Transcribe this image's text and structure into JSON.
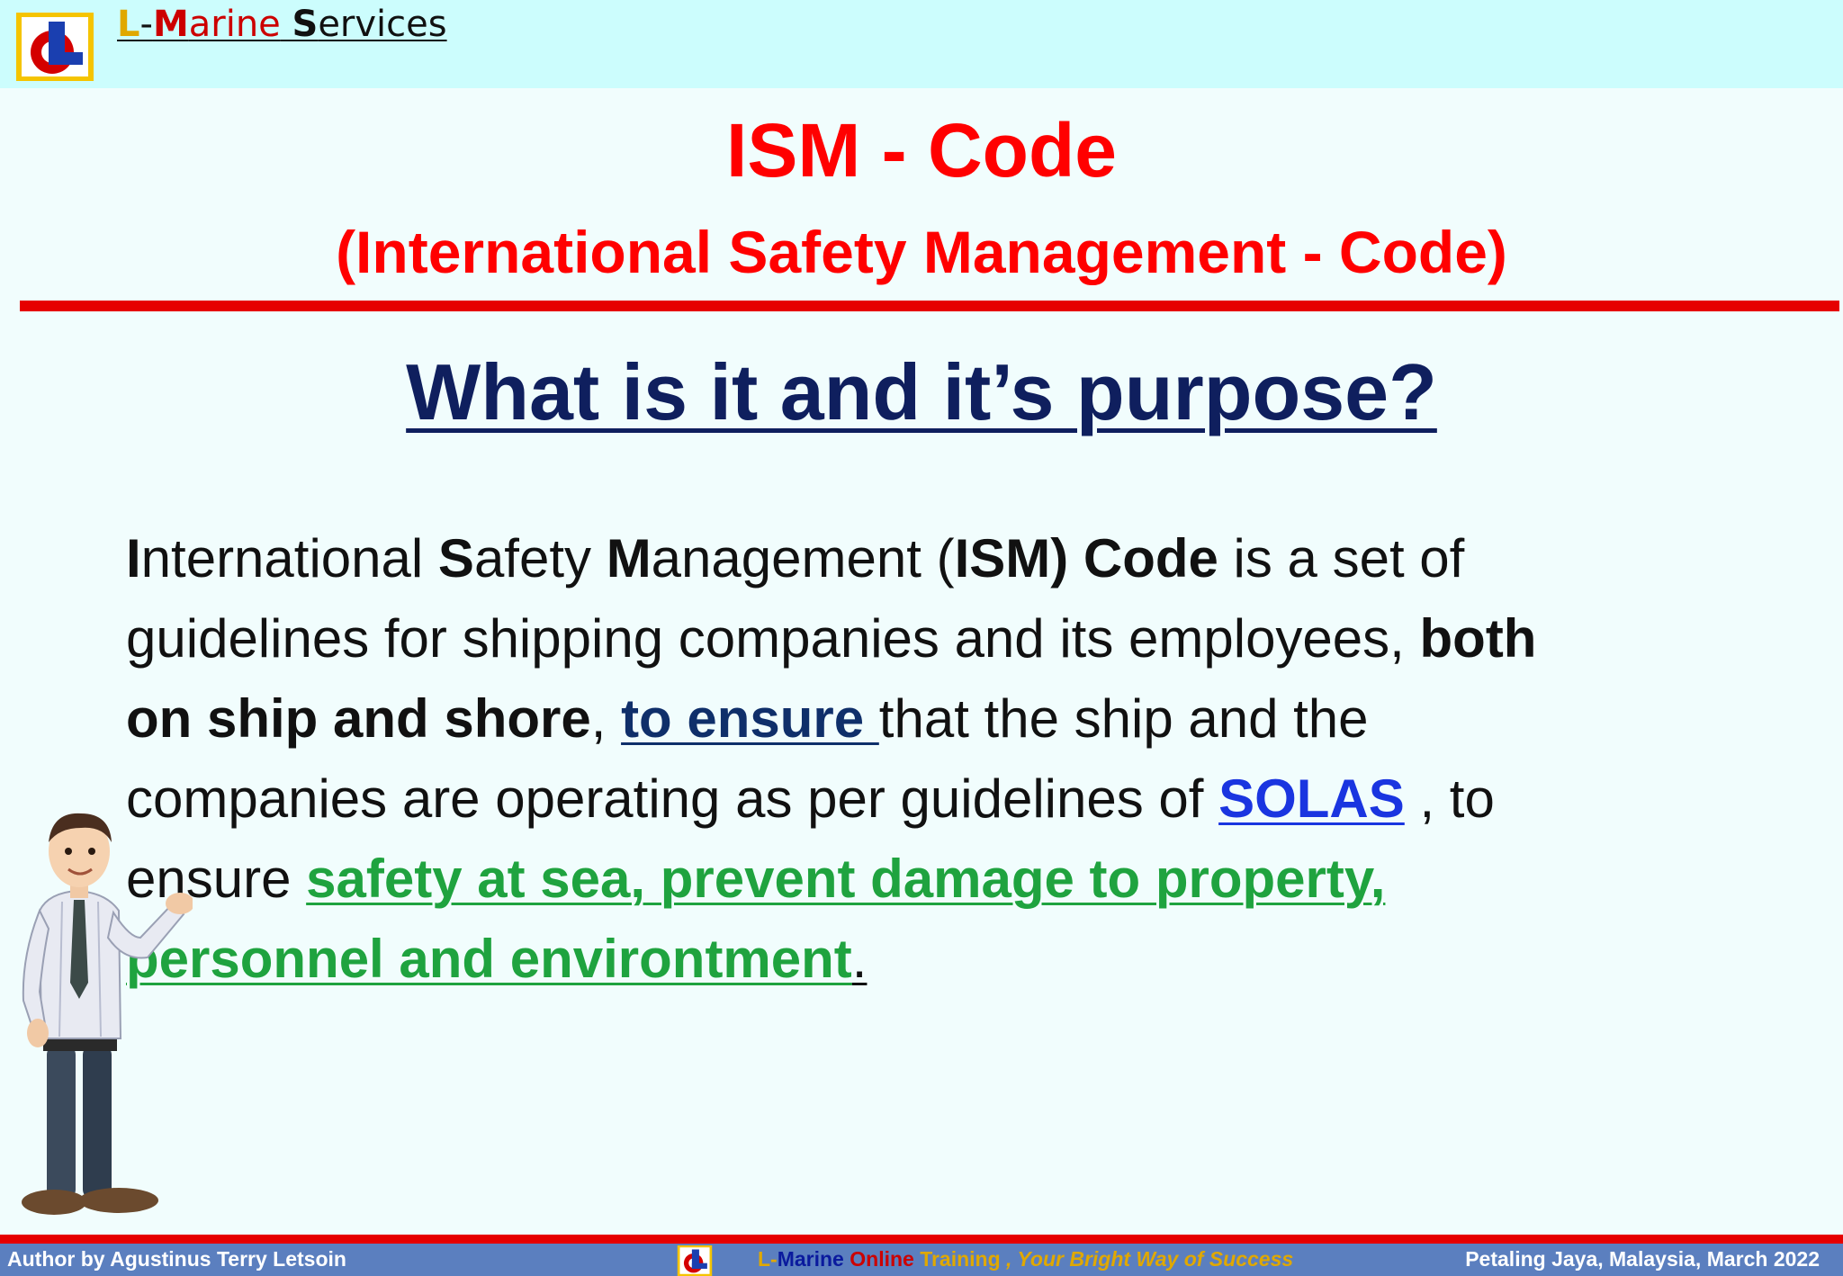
{
  "header": {
    "brand_l": "L",
    "brand_dash": "-",
    "brand_m": "M",
    "brand_arine": "arine",
    "brand_space": " ",
    "brand_s": "S",
    "brand_ervices": "ervices"
  },
  "slide": {
    "title": "ISM - Code",
    "subtitle": "(International Safety Management - Code)",
    "question": "What is it and it’s purpose?"
  },
  "body": {
    "l1_I": "I",
    "l1_a": "nternational ",
    "l1_S": "S",
    "l1_b": "afety ",
    "l1_M": "M",
    "l1_c": "anagement (",
    "l1_ism": "ISM) Code",
    "l1_d": " is a set of",
    "l2_a": "guidelines for shipping companies and its employees, ",
    "l2_both": "both",
    "l3_bold": "on ship and shore",
    "l3_comma": ", ",
    "l3_ensure": "to ensure ",
    "l3_rest": "that the ship and the",
    "l4_a": "companies are operating as per guidelines of ",
    "l4_solas": "SOLAS",
    "l4_b": " , to",
    "l5_a": "ensure  ",
    "l5_green": "safety at sea, prevent damage to property,",
    "l6_green": "personnel and environtment",
    "l6_period": "."
  },
  "footer": {
    "author": "Author by Agustinus Terry Letsoin",
    "c_l": "L-",
    "c_marine": "Marine",
    "c_online": " Online",
    "c_training": " Training",
    "c_slogan": "  ,  Your Bright Way of Success",
    "location": "Petaling Jaya, Malaysia, March 2022"
  },
  "colors": {
    "title_red": "#ff0000",
    "question_navy": "#0f1f5e",
    "link_blue": "#1a35e0",
    "highlight_green": "#1fa33f",
    "header_bg": "#ccfdfd",
    "footer_bg": "#5b7fbf"
  },
  "icons": {
    "logo": "lmarine-logo-icon",
    "presenter": "presenter-figure-icon"
  }
}
